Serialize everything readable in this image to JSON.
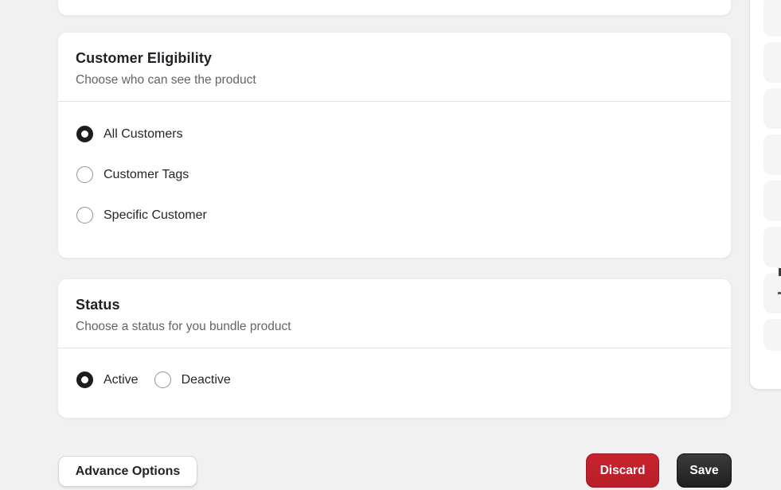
{
  "colors": {
    "page_bg": "#f1f1f1",
    "title_color": "#1f2124",
    "subtitle_color": "#61656a",
    "label_color": "#24262a",
    "radio_selected": "#1c1d1f",
    "radio_border": "#8f9296",
    "discard_red": "#c8232e",
    "save_dark": "#1f1f1f"
  },
  "customer_eligibility": {
    "title": "Customer Eligibility",
    "subtitle": "Choose who can see the product",
    "options": [
      {
        "label": "All Customers",
        "selected": true
      },
      {
        "label": "Customer Tags",
        "selected": false
      },
      {
        "label": "Specific Customer",
        "selected": false
      }
    ]
  },
  "status": {
    "title": "Status",
    "subtitle": "Choose a status for you bundle product",
    "options": [
      {
        "label": "Active",
        "selected": true
      },
      {
        "label": "Deactive",
        "selected": false
      }
    ]
  },
  "actions": {
    "advance_options": "Advance Options",
    "discard": "Discard",
    "save": "Save"
  }
}
